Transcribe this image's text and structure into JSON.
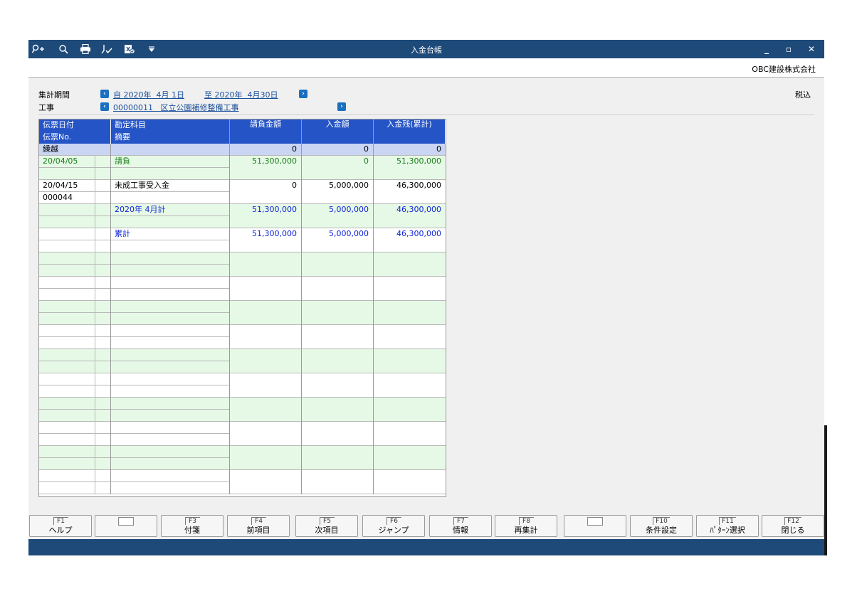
{
  "window": {
    "title": "入金台帳",
    "company": "OBC建設株式会社",
    "toolbar_icons": [
      "search-plus-icon",
      "search-document-icon",
      "print-icon",
      "hand-check-icon",
      "excel-export-icon",
      "dropdown-arrow-icon"
    ],
    "controls": {
      "minimize": "_",
      "restore": "▫",
      "close": "✕"
    }
  },
  "filters": {
    "period_label": "集計期間",
    "period_from": "自 2020年  4月 1日",
    "period_to": "至 2020年  4月30日",
    "project_label": "工事",
    "project_value": "00000011   区立公園補修整備工事",
    "tax_mode": "税込"
  },
  "table": {
    "headers_top": [
      "伝票日付",
      "勘定科目",
      "請負金額",
      "入金額",
      "入金残(累計)"
    ],
    "headers_bottom": [
      "伝票No.",
      "摘要"
    ],
    "rows": [
      {
        "date": "繰越",
        "no": "",
        "account": "",
        "summary": "",
        "contract": "0",
        "payment": "0",
        "balance": "0",
        "style": "carry"
      },
      {
        "date": "20/04/05",
        "no": "",
        "account": "請負",
        "summary": "",
        "contract": "51,300,000",
        "payment": "0",
        "balance": "51,300,000",
        "style": "green-text"
      },
      {
        "date": "20/04/15",
        "no": "000044",
        "account": "未成工事受入金",
        "summary": "",
        "contract": "0",
        "payment": "5,000,000",
        "balance": "46,300,000",
        "style": "black-text"
      },
      {
        "date": "",
        "no": "",
        "account": "2020年  4月計",
        "summary": "",
        "contract": "51,300,000",
        "payment": "5,000,000",
        "balance": "46,300,000",
        "style": "blue-text"
      },
      {
        "date": "",
        "no": "",
        "account": "累計",
        "summary": "",
        "contract": "51,300,000",
        "payment": "5,000,000",
        "balance": "46,300,000",
        "style": "blue-text"
      }
    ]
  },
  "fkeys": [
    {
      "key": "F1",
      "label": "ヘルプ"
    },
    {
      "key": "",
      "label": ""
    },
    {
      "key": "F3",
      "label": "付箋"
    },
    {
      "key": "F4",
      "label": "前項目"
    },
    {
      "key": "F5",
      "label": "次項目"
    },
    {
      "key": "F6",
      "label": "ジャンプ"
    },
    {
      "key": "F7",
      "label": "情報"
    },
    {
      "key": "F8",
      "label": "再集計"
    },
    {
      "key": "",
      "label": ""
    },
    {
      "key": "F10",
      "label": "条件設定"
    },
    {
      "key": "F11",
      "label": "ﾊﾟﾀｰﾝ選択"
    },
    {
      "key": "F12",
      "label": "閉じる"
    }
  ]
}
